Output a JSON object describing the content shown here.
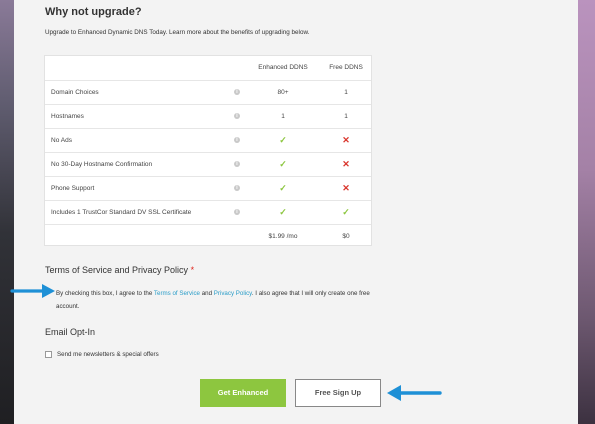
{
  "upgrade": {
    "heading": "Why not upgrade?",
    "subtitle": "Upgrade to Enhanced Dynamic DNS Today. Learn more about the benefits of upgrading below."
  },
  "comparison": {
    "headers": {
      "enhanced": "Enhanced DDNS",
      "free": "Free DDNS"
    },
    "rows": [
      {
        "feature": "Domain Choices",
        "enhanced": "80+",
        "free": "1"
      },
      {
        "feature": "Hostnames",
        "enhanced": "1",
        "free": "1"
      },
      {
        "feature": "No Ads",
        "enhanced": "check",
        "free": "cross"
      },
      {
        "feature": "No 30-Day Hostname Confirmation",
        "enhanced": "check",
        "free": "cross"
      },
      {
        "feature": "Phone Support",
        "enhanced": "check",
        "free": "cross"
      },
      {
        "feature": "Includes 1 TrustCor Standard DV SSL Certificate",
        "enhanced": "check",
        "free": "check"
      }
    ],
    "price": {
      "enhanced": "$1.99 /mo",
      "free": "$0"
    }
  },
  "terms": {
    "heading": "Terms of Service and Privacy Policy",
    "required_mark": "*",
    "text_before": "By checking this box, I agree to the ",
    "tos_link": "Terms of Service",
    "and": " and ",
    "privacy_link": "Privacy Policy",
    "text_after": ". I also agree that I will only create one free account."
  },
  "email_optin": {
    "heading": "Email Opt-In",
    "checkbox_label": "Send me newsletters & special offers"
  },
  "buttons": {
    "enhanced": "Get Enhanced",
    "free": "Free Sign Up"
  },
  "colors": {
    "check": "#8cc63f",
    "cross": "#d9342b",
    "link": "#2a9dc8",
    "primary_button": "#8dc63f",
    "annotation_arrow": "#1e90d6"
  }
}
